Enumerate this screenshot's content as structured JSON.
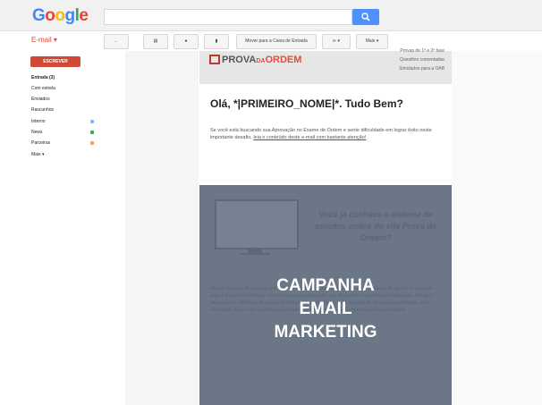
{
  "header": {
    "logo_letters": [
      {
        "ch": "G",
        "color": "#4285f4"
      },
      {
        "ch": "o",
        "color": "#ea4335"
      },
      {
        "ch": "o",
        "color": "#fbbc05"
      },
      {
        "ch": "g",
        "color": "#4285f4"
      },
      {
        "ch": "l",
        "color": "#34a853"
      },
      {
        "ch": "e",
        "color": "#ea4335"
      }
    ],
    "search_value": "",
    "search_icon": "search-icon"
  },
  "toolbar": {
    "mail_label": "E-mail ▾",
    "back_label": "←",
    "archive_label": "▤",
    "spam_label": "●",
    "delete_label": "▮",
    "move_label": "Mover para a Caixa de Entrada",
    "labels_label": "⊳ ▾",
    "more_label": "Mais ▾"
  },
  "sidebar": {
    "compose_label": "ESCREVER",
    "items": [
      {
        "label": "Entrada (3)",
        "bold": true
      },
      {
        "label": "Com estrela"
      },
      {
        "label": "Enviados"
      },
      {
        "label": "Rascunhos"
      },
      {
        "label": "Interno",
        "dot": "#8ab4f8"
      },
      {
        "label": "News",
        "dot": "#34a853"
      },
      {
        "label": "Parceiras",
        "dot": "#f4a742"
      },
      {
        "label": "Mais ▾"
      }
    ]
  },
  "email": {
    "brand_main": "PROVA",
    "brand_small": "DA",
    "brand_accent": "ORDEM",
    "side_lines": [
      "Provas de 1ª e 2ª fase",
      "Questões comentadas",
      "Simulados para a OAB"
    ],
    "greeting": "Olá, *|PRIMEIRO_NOME|*. Tudo Bem?",
    "intro_text": "Se você está buscando sua Aprovação no Exame de Ordem e sente dificuldade em lograr êxito neste importante desafio, ",
    "intro_link": "leia o conteúdo deste e-mail com bastante atenção!",
    "promo_title": "Você já conhece o sistema de estudos online do site Prova da Ordem?",
    "promo_body": "Nosso sistema de estudos online foi desenvolvido para atender às necessidades de quem se prepara para o Exame de Ordem, com conteúdos organizados por disciplina e questões comentadas. Desde o lançamento, milhares de alunos já utilizaram a plataforma para estudar de forma mais eficiente, com simulados, banco de questões e acompanhamento do seu desempenho em cada matéria.",
    "overlay_lines": [
      "CAMPANHA",
      "EMAIL",
      "MARKETING"
    ]
  }
}
